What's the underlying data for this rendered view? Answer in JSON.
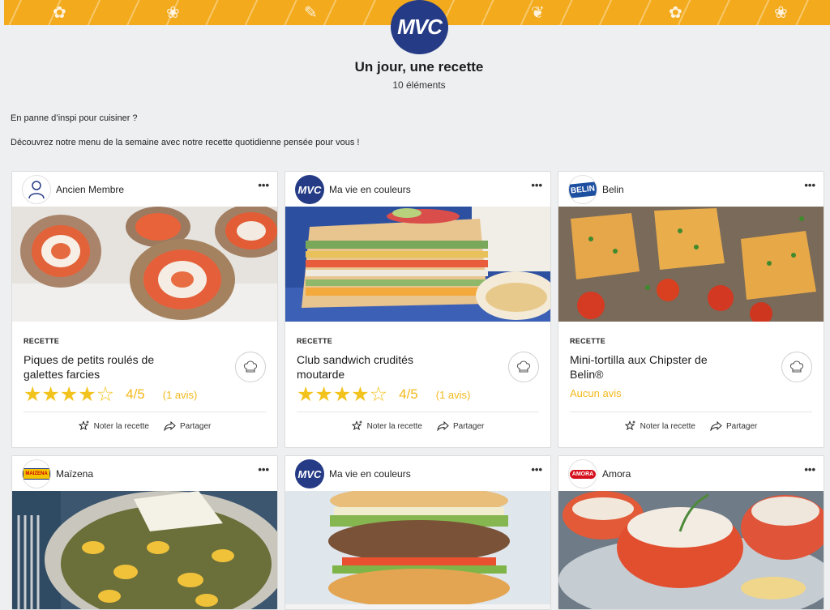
{
  "header": {
    "logo_text": "MVC",
    "title": "Un jour, une recette",
    "count": "10 éléments"
  },
  "intro": {
    "line1": "En panne d’inspi pour cuisiner ?",
    "line2": "Découvrez notre menu de la semaine avec notre recette quotidienne pensée pour vous !"
  },
  "colors": {
    "accent": "#f3b81b",
    "brand": "#253b86",
    "banner": "#f3aa1c"
  },
  "cards": [
    {
      "author": "Ancien Membre",
      "avatar_icon": "user-icon",
      "type": "RECETTE",
      "title": "Piques de petits roulés de galettes farcies",
      "rating": 4,
      "score": "4/5",
      "avis": "(1 avis)",
      "rate_label": "Noter la recette",
      "share_label": "Partager"
    },
    {
      "author": "Ma vie en couleurs",
      "avatar_icon": "mvc-logo",
      "type": "RECETTE",
      "title": "Club sandwich crudités moutarde",
      "rating": 4,
      "score": "4/5",
      "avis": "(1 avis)",
      "rate_label": "Noter la recette",
      "share_label": "Partager"
    },
    {
      "author": "Belin",
      "avatar_icon": "belin-logo",
      "avatar_text": "BELIN",
      "type": "RECETTE",
      "title": "Mini-tortilla aux Chipster de Belin®",
      "no_avis": "Aucun avis",
      "rate_label": "Noter la recette",
      "share_label": "Partager"
    },
    {
      "author": "Maïzena",
      "avatar_icon": "maizena-logo",
      "avatar_text": "MAIZENA"
    },
    {
      "author": "Ma vie en couleurs",
      "avatar_icon": "mvc-logo"
    },
    {
      "author": "Amora",
      "avatar_icon": "amora-logo",
      "avatar_text": "AMORA"
    }
  ],
  "more_label": "•••",
  "star_full": "★",
  "star_empty": "☆"
}
